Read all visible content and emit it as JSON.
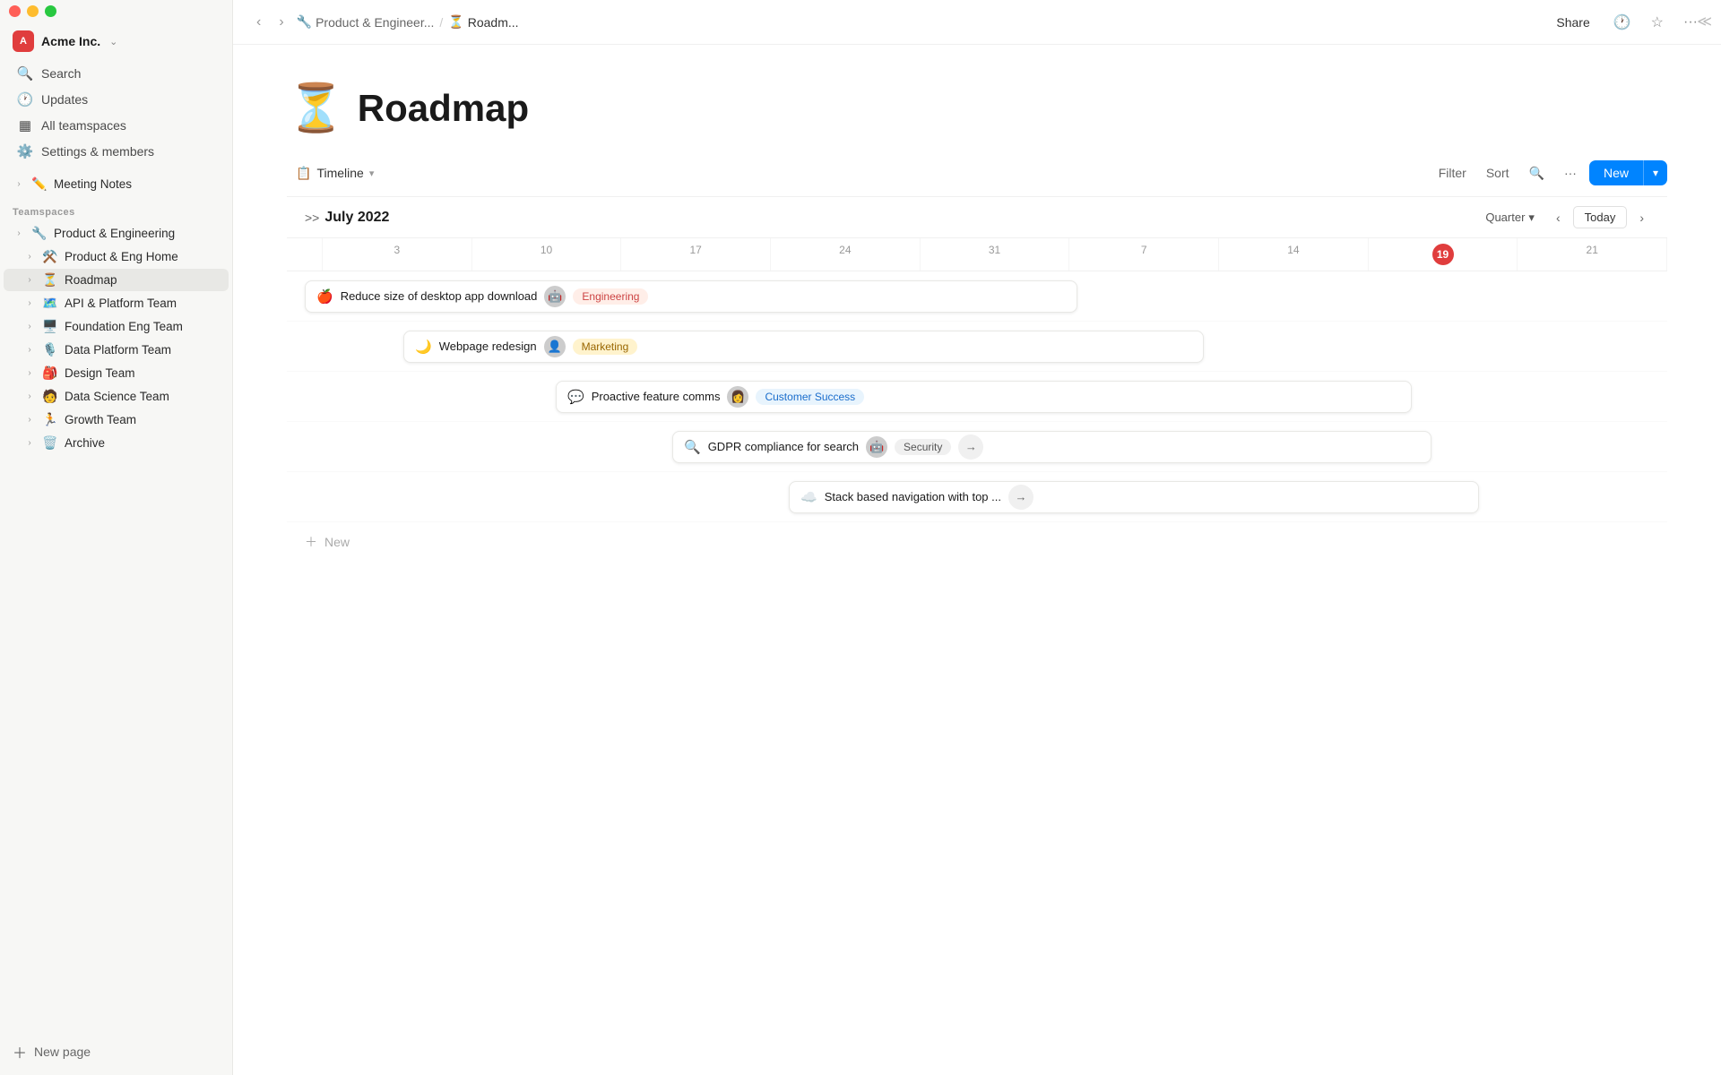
{
  "app": {
    "title": "Roadmap",
    "icon": "⏳"
  },
  "window": {
    "traffic_lights": [
      "red",
      "yellow",
      "green"
    ]
  },
  "sidebar": {
    "workspace": {
      "name": "Acme Inc.",
      "icon_text": "A",
      "icon_bg": "#e03d3d"
    },
    "nav_items": [
      {
        "id": "search",
        "icon": "🔍",
        "label": "Search"
      },
      {
        "id": "updates",
        "icon": "🕐",
        "label": "Updates"
      },
      {
        "id": "all-teamspaces",
        "icon": "📊",
        "label": "All teamspaces"
      },
      {
        "id": "settings",
        "icon": "⚙️",
        "label": "Settings & members"
      }
    ],
    "pinned": [
      {
        "id": "meeting-notes",
        "icon": "✏️",
        "label": "Meeting Notes",
        "expanded": false
      }
    ],
    "teamspaces_label": "Teamspaces",
    "teamspaces": [
      {
        "id": "product-engineering",
        "icon": "🔧",
        "label": "Product & Engineering",
        "expanded": true
      },
      {
        "id": "product-eng-home",
        "icon": "⚒️",
        "label": "Product & Eng Home",
        "expanded": false
      },
      {
        "id": "roadmap",
        "icon": "⏳",
        "label": "Roadmap",
        "expanded": false,
        "active": true
      },
      {
        "id": "api-platform",
        "icon": "🗺️",
        "label": "API & Platform Team",
        "expanded": false
      },
      {
        "id": "foundation-eng",
        "icon": "🖥️",
        "label": "Foundation Eng Team",
        "expanded": false
      },
      {
        "id": "data-platform",
        "icon": "🎙️",
        "label": "Data Platform Team",
        "expanded": false
      },
      {
        "id": "design-team",
        "icon": "🎒",
        "label": "Design Team",
        "expanded": false
      },
      {
        "id": "data-science",
        "icon": "🧑",
        "label": "Data Science Team",
        "expanded": false
      },
      {
        "id": "growth-team",
        "icon": "🏃",
        "label": "Growth Team",
        "expanded": false
      },
      {
        "id": "archive",
        "icon": "🗑️",
        "label": "Archive",
        "expanded": false
      }
    ],
    "new_page_label": "New page"
  },
  "titlebar": {
    "breadcrumb": [
      {
        "icon": "🔧",
        "label": "Product & Engineer..."
      },
      {
        "icon": "⏳",
        "label": "Roadm..."
      }
    ],
    "share_label": "Share",
    "actions": [
      "history",
      "favorite",
      "more"
    ]
  },
  "toolbar": {
    "view_icon": "📋",
    "view_label": "Timeline",
    "filter_label": "Filter",
    "sort_label": "Sort",
    "new_label": "New"
  },
  "timeline": {
    "month": "July 2022",
    "quarter_label": "Quarter",
    "today_label": "Today",
    "dates": [
      "3",
      "10",
      "17",
      "24",
      "31",
      "7",
      "14",
      "19",
      "21"
    ],
    "today_date": "19",
    "tasks": [
      {
        "id": "task1",
        "emoji": "🍎",
        "label": "Reduce size of desktop app download",
        "tag": "Engineering",
        "tag_class": "tag-engineering",
        "avatar": "🤖",
        "left_pct": 0,
        "width_pct": 54
      },
      {
        "id": "task2",
        "emoji": "🌙",
        "label": "Webpage redesign",
        "tag": "Marketing",
        "tag_class": "tag-marketing",
        "avatar": "👤",
        "left_pct": 12,
        "width_pct": 56
      },
      {
        "id": "task3",
        "emoji": "💬",
        "label": "Proactive feature comms",
        "tag": "Customer Success",
        "tag_class": "tag-customer-success",
        "avatar": "👩",
        "left_pct": 29,
        "width_pct": 62
      },
      {
        "id": "task4",
        "emoji": "🔍",
        "label": "GDPR compliance for search",
        "tag": "Security",
        "tag_class": "tag-security",
        "avatar": "🤖",
        "left_pct": 42,
        "width_pct": 58,
        "has_arrow": true
      },
      {
        "id": "task5",
        "emoji": "☁️",
        "label": "Stack based navigation with top ...",
        "tag": "",
        "tag_class": "",
        "avatar": "",
        "left_pct": 55,
        "width_pct": 45,
        "has_arrow": true
      }
    ],
    "new_label": "New"
  }
}
